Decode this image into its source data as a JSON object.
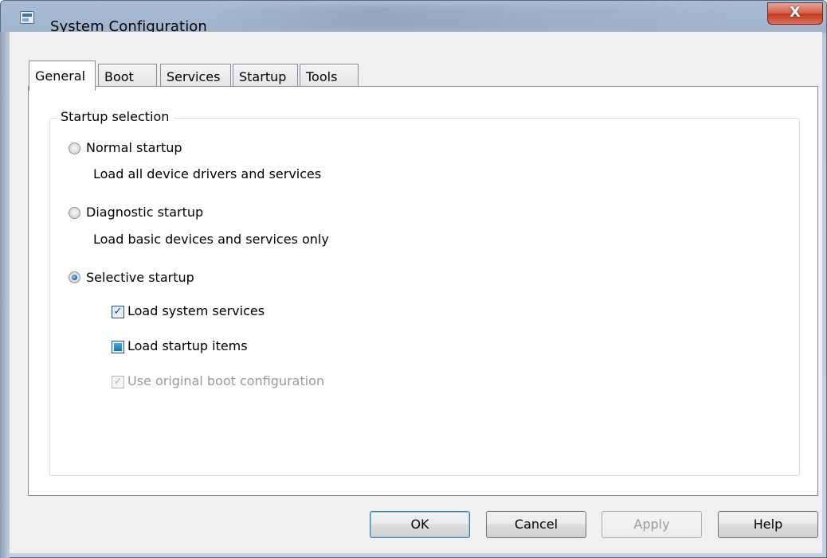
{
  "window": {
    "title": "System Configuration",
    "close_label": "X"
  },
  "tabs": [
    {
      "label": "General",
      "active": true
    },
    {
      "label": "Boot",
      "active": false
    },
    {
      "label": "Services",
      "active": false
    },
    {
      "label": "Startup",
      "active": false
    },
    {
      "label": "Tools",
      "active": false
    }
  ],
  "startup_selection": {
    "group_title": "Startup selection",
    "normal": {
      "label": "Normal startup",
      "description": "Load all device drivers and services",
      "selected": false
    },
    "diagnostic": {
      "label": "Diagnostic startup",
      "description": "Load basic devices and services only",
      "selected": false
    },
    "selective": {
      "label": "Selective startup",
      "selected": true
    },
    "options": {
      "load_system_services": {
        "label": "Load system services",
        "state": "checked"
      },
      "load_startup_items": {
        "label": "Load startup items",
        "state": "indeterminate"
      },
      "use_original_boot": {
        "label": "Use original boot configuration",
        "state": "checked-disabled"
      }
    }
  },
  "buttons": {
    "ok": "OK",
    "cancel": "Cancel",
    "apply": "Apply",
    "help": "Help"
  }
}
